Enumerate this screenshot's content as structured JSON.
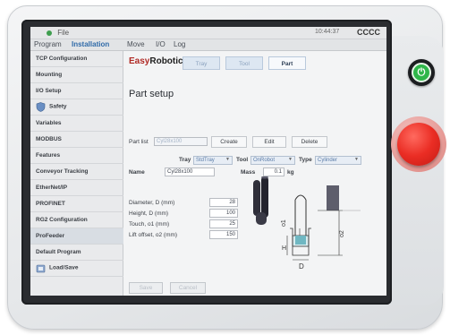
{
  "topbar": {
    "file_label": "File",
    "time": "10:44:37",
    "user": "CCCC"
  },
  "menu_tabs": [
    "Program",
    "Installation",
    "Move",
    "I/O",
    "Log"
  ],
  "sidebar": {
    "items": [
      {
        "label": "TCP Configuration"
      },
      {
        "label": "Mounting"
      },
      {
        "label": "I/O Setup"
      },
      {
        "label": "Safety",
        "icon": "shield-icon"
      },
      {
        "label": "Variables"
      },
      {
        "label": "MODBUS"
      },
      {
        "label": "Features"
      },
      {
        "label": "Conveyor Tracking"
      },
      {
        "label": "EtherNet/IP"
      },
      {
        "label": "PROFINET"
      },
      {
        "label": "RG2 Configuration"
      },
      {
        "label": "ProFeeder",
        "selected": true
      },
      {
        "label": "Default Program"
      },
      {
        "label": "Load/Save",
        "icon": "folder-icon"
      }
    ]
  },
  "brand": {
    "easy": "Easy",
    "robotics": "Robotics"
  },
  "top_tabs": [
    {
      "label": "Tray",
      "active": false
    },
    {
      "label": "Tool",
      "active": false
    },
    {
      "label": "Part",
      "active": true
    }
  ],
  "part_setup": {
    "title": "Part setup",
    "part_list_label": "Part list",
    "part_list_value": "Cyl28x100",
    "create": "Create",
    "edit": "Edit",
    "delete": "Delete",
    "tray_label": "Tray",
    "tray_value": "StdTray",
    "tool_label": "Tool",
    "tool_value": "OnRobot",
    "type_label": "Type",
    "type_value": "Cylinder",
    "name_label": "Name",
    "name_value": "Cyl28x100",
    "mass_label": "Mass",
    "mass_value": "0.1",
    "mass_unit": "kg",
    "fields": [
      {
        "label": "Diameter, D (mm)",
        "value": "28"
      },
      {
        "label": "Height, D (mm)",
        "value": "100"
      },
      {
        "label": "Touch, o1 (mm)",
        "value": "25"
      },
      {
        "label": "Lift offset, o2 (mm)",
        "value": "150"
      }
    ],
    "save": "Save",
    "cancel": "Cancel"
  },
  "diagram_labels": {
    "o1": "o1",
    "o2": "o2",
    "H": "H",
    "D": "D"
  },
  "colors": {
    "accent": "#2f6aa8",
    "power": "#2fb64a",
    "estop": "#ea2d24",
    "brand_red": "#b02a25"
  }
}
